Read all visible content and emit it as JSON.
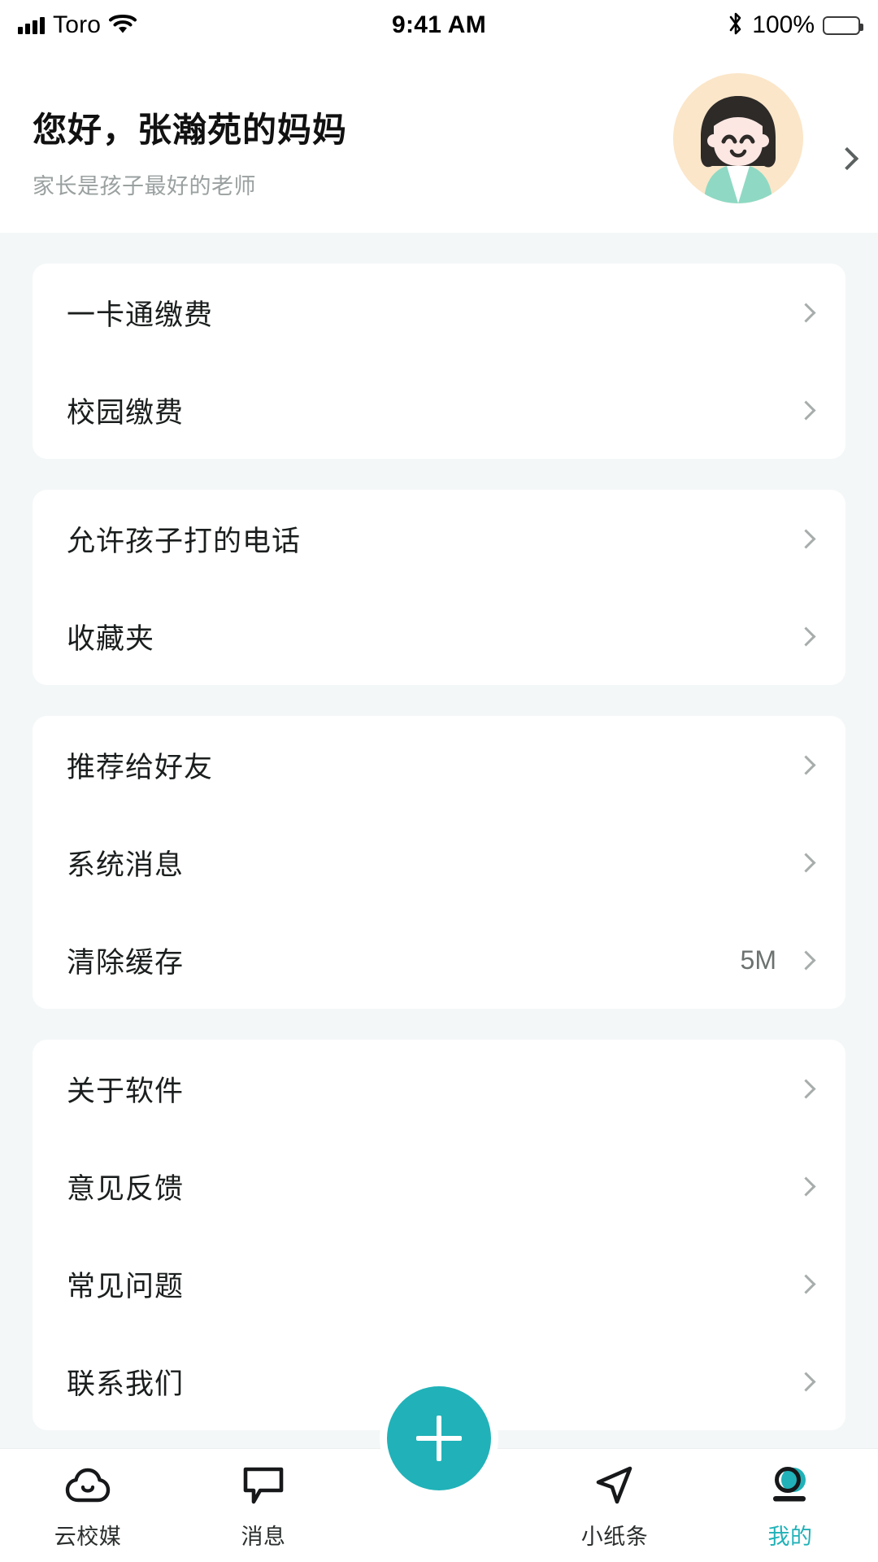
{
  "status_bar": {
    "carrier": "Toro",
    "time": "9:41 AM",
    "battery_percent": "100%",
    "signal_icon": "signal-bars-icon",
    "wifi_icon": "wifi-icon",
    "bluetooth_icon": "bluetooth-icon",
    "battery_icon": "battery-full-icon"
  },
  "header": {
    "greeting": "您好，张瀚苑的妈妈",
    "subtitle": "家长是孩子最好的老师",
    "avatar_icon": "avatar",
    "chevron_icon": "chevron-right-icon",
    "avatar_colors": {
      "background": "#FBE6C9",
      "hair": "#2D2A28",
      "face": "#FCE7E3",
      "clothing": "#8FD9C4",
      "collar": "#FFFFFF"
    }
  },
  "cards": [
    {
      "rows": [
        {
          "label": "一卡通缴费",
          "value": "",
          "chevron": "chevron-right-icon"
        },
        {
          "label": "校园缴费",
          "value": "",
          "chevron": "chevron-right-icon"
        }
      ]
    },
    {
      "rows": [
        {
          "label": "允许孩子打的电话",
          "value": "",
          "chevron": "chevron-right-icon"
        },
        {
          "label": "收藏夹",
          "value": "",
          "chevron": "chevron-right-icon"
        }
      ]
    },
    {
      "rows": [
        {
          "label": "推荐给好友",
          "value": "",
          "chevron": "chevron-right-icon"
        },
        {
          "label": "系统消息",
          "value": "",
          "chevron": "chevron-right-icon"
        },
        {
          "label": "清除缓存",
          "value": "5M",
          "chevron": "chevron-right-icon"
        }
      ]
    },
    {
      "rows": [
        {
          "label": "关于软件",
          "value": "",
          "chevron": "chevron-right-icon"
        },
        {
          "label": "意见反馈",
          "value": "",
          "chevron": "chevron-right-icon"
        },
        {
          "label": "常见问题",
          "value": "",
          "chevron": "chevron-right-icon"
        },
        {
          "label": "联系我们",
          "value": "",
          "chevron": "chevron-right-icon"
        }
      ]
    }
  ],
  "tabbar": {
    "accent_color": "#20B2B8",
    "items": [
      {
        "label": "云校媒",
        "icon": "cloud-icon",
        "active": false
      },
      {
        "label": "消息",
        "icon": "chat-bubble-icon",
        "active": false
      },
      {
        "label": "小纸条",
        "icon": "paper-plane-icon",
        "active": false
      },
      {
        "label": "我的",
        "icon": "person-icon",
        "active": true
      }
    ],
    "fab": {
      "icon": "plus-icon",
      "label": ""
    }
  }
}
